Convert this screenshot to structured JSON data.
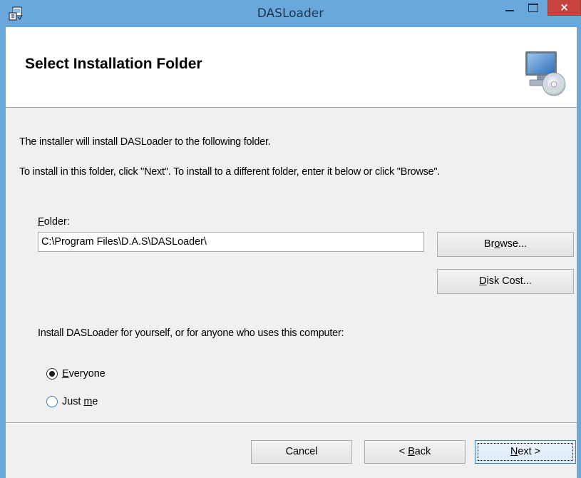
{
  "window": {
    "title": "DASLoader",
    "close_glyph": "×",
    "icons": {
      "app": "installer-icon",
      "minimize": "minimize-icon",
      "maximize": "maximize-icon",
      "close": "close-icon"
    },
    "colors": {
      "titlebar": "#6aa8dc",
      "close": "#c7433e"
    }
  },
  "banner": {
    "title": "Select Installation Folder",
    "icon": "computer-cd-icon"
  },
  "body": {
    "intro": "The installer will install DASLoader to the following folder.",
    "instructions": "To install in this folder, click \"Next\". To install to a different folder, enter it below or click \"Browse\"."
  },
  "folder": {
    "label_mnemonic": "F",
    "label_rest": "older:",
    "value": "C:\\Program Files\\D.A.S\\DASLoader\\"
  },
  "buttons": {
    "browse_pre": "Br",
    "browse_mnemonic": "o",
    "browse_post": "wse...",
    "disk_mnemonic": "D",
    "disk_post": "isk Cost...",
    "cancel": "Cancel",
    "back_pre": "< ",
    "back_mnemonic": "B",
    "back_post": "ack",
    "next_mnemonic": "N",
    "next_post": "ext >"
  },
  "install_for": {
    "prompt": "Install DASLoader for yourself, or for anyone who uses this computer:",
    "options": [
      {
        "mnemonic": "E",
        "rest": "veryone",
        "selected": true
      },
      {
        "pre": "Just ",
        "mnemonic": "m",
        "rest": "e",
        "selected": false
      }
    ]
  }
}
